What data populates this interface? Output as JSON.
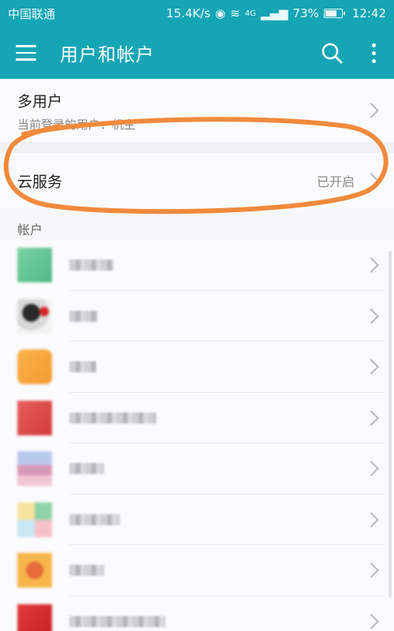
{
  "status_bar": {
    "carrier": "中国联通",
    "speed": "15.4K/s",
    "network": "4G",
    "battery": "73%",
    "battery_level": 0.73,
    "time": "12:42"
  },
  "app_bar": {
    "title": "用户和帐户",
    "icons": [
      "menu-icon",
      "search-icon",
      "more-vertical-icon"
    ]
  },
  "multi_user": {
    "label": "多用户",
    "subtitle": "当前登录的用户：机主"
  },
  "cloud": {
    "label": "云服务",
    "status": "已开启"
  },
  "accounts_section": {
    "header": "帐户",
    "note": "account names and icons are pixelated/obscured in the screenshot"
  },
  "colors": {
    "accent": "#15a5b5",
    "annotation": "#f08a3c"
  }
}
